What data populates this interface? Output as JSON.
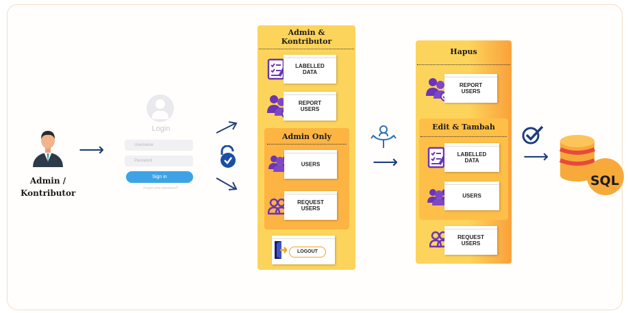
{
  "actor": {
    "label_line1": "Admin /",
    "label_line2": "Kontributor"
  },
  "login": {
    "title": "Login",
    "username_placeholder": "Username",
    "password_placeholder": "Password",
    "signin_label": "Sign in",
    "forgot_text": "Forgot your password?"
  },
  "panel1": {
    "title": "Admin &\nKontributor",
    "cards": {
      "labelled": "LABELLED\nDATA",
      "report": "REPORT\nUSERS"
    },
    "admin_only": {
      "title": "Admin Only",
      "cards": {
        "users": "USERS",
        "request": "REQUEST\nUSERS"
      }
    },
    "logout": "LOGOUT"
  },
  "panel2": {
    "hapus": {
      "title": "Hapus",
      "report": "REPORT\nUSERS"
    },
    "edit": {
      "title": "Edit & Tambah",
      "cards": {
        "labelled": "LABELLED\nDATA",
        "users": "USERS",
        "request": "REQUEST\nUSERS"
      }
    }
  },
  "database": {
    "label": "SQL"
  },
  "colors": {
    "panel_yellow": "#fdd45b",
    "sub_orange": "#fdb443",
    "arrow_navy": "#1f3d7a",
    "icon_purple": "#6b35b5",
    "db_red": "#e64a3c",
    "db_orange": "#f7a93a",
    "signin_blue": "#3ea3e6"
  },
  "icons": [
    "admin-person-icon",
    "unlock-check-icon",
    "decision-split-icon",
    "check-circle-icon",
    "database-icon",
    "checklist-pen-icon",
    "group-check-icon",
    "group-icon",
    "add-user-icon",
    "logout-door-icon"
  ]
}
